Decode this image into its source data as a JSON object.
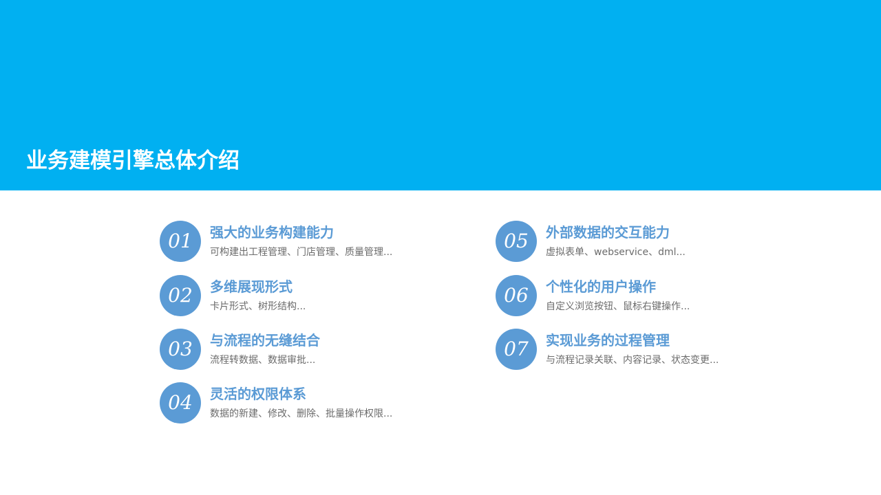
{
  "slide": {
    "title": "业务建模引擎总体介绍"
  },
  "colors": {
    "header_band": "#01b0f1",
    "accent": "#5b9bd5",
    "description_text": "#6b6b6b",
    "background": "#ffffff"
  },
  "items": [
    {
      "number": "01",
      "title": "强大的业务构建能力",
      "description": "可构建出工程管理、门店管理、质量管理..."
    },
    {
      "number": "02",
      "title": "多维展现形式",
      "description": "卡片形式、树形结构..."
    },
    {
      "number": "03",
      "title": "与流程的无缝结合",
      "description": "流程转数据、数据审批..."
    },
    {
      "number": "04",
      "title": "灵活的权限体系",
      "description": "数据的新建、修改、删除、批量操作权限..."
    },
    {
      "number": "05",
      "title": "外部数据的交互能力",
      "description": "虚拟表单、webservice、dml..."
    },
    {
      "number": "06",
      "title": "个性化的用户操作",
      "description": "自定义浏览按钮、鼠标右键操作..."
    },
    {
      "number": "07",
      "title": "实现业务的过程管理",
      "description": "与流程记录关联、内容记录、状态变更..."
    }
  ]
}
